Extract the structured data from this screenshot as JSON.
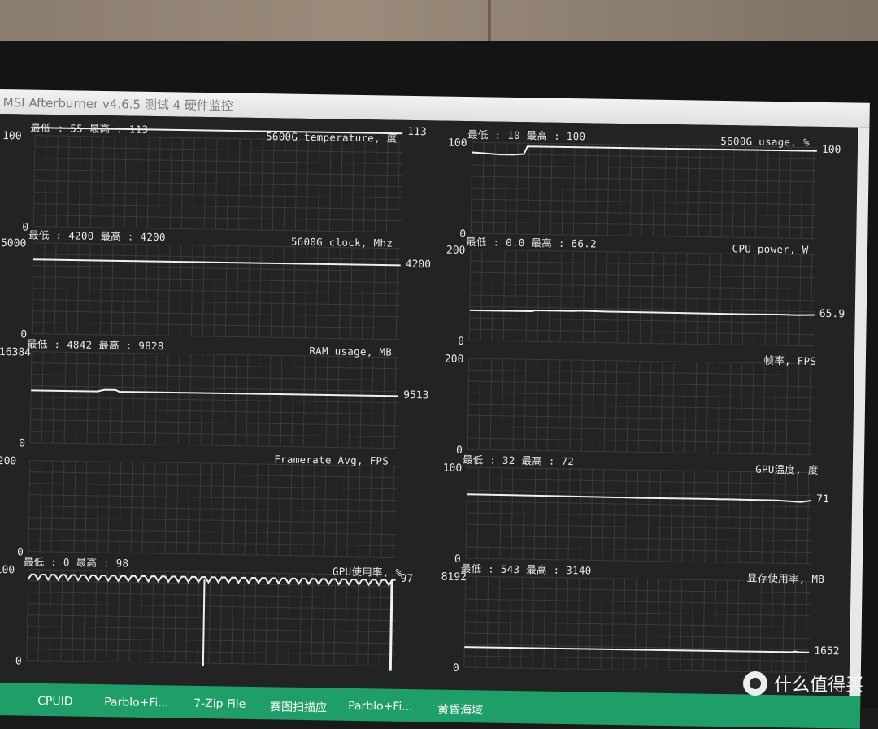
{
  "window": {
    "title": "MSI Afterburner v4.6.5 测试 4 硬件监控"
  },
  "graphs": [
    {
      "id": "cpu-temp",
      "title": "5600G temperature, 度",
      "stats": "最低 : 55  最高 : 113",
      "ymax": "100",
      "ymin": "0",
      "current": "113",
      "y_scale_max": 100,
      "trace": [
        [
          0,
          113
        ],
        [
          1,
          113
        ]
      ]
    },
    {
      "id": "cpu-usage",
      "title": "5600G usage, %",
      "stats": "最低 : 10  最高 : 100",
      "ymax": "100",
      "ymin": "0",
      "current": "100",
      "y_scale_max": 100,
      "trace": [
        [
          0,
          92
        ],
        [
          0.04,
          91
        ],
        [
          0.08,
          90
        ],
        [
          0.12,
          90
        ],
        [
          0.15,
          91
        ],
        [
          0.16,
          100
        ],
        [
          1,
          100
        ]
      ]
    },
    {
      "id": "cpu-clock",
      "title": "5600G clock, Mhz",
      "stats": "最低 : 4200  最高 : 4200",
      "ymax": "5000",
      "ymin": "0",
      "current": "4200",
      "y_scale_max": 5000,
      "trace": [
        [
          0,
          4200
        ],
        [
          1,
          4200
        ]
      ]
    },
    {
      "id": "cpu-power",
      "title": "CPU power, W",
      "stats": "最低 : 0.0  最高 : 66.2",
      "ymax": "200",
      "ymin": "0",
      "current": "65.9",
      "y_scale_max": 200,
      "trace": [
        [
          0,
          64
        ],
        [
          0.18,
          64
        ],
        [
          0.19,
          66
        ],
        [
          0.3,
          66
        ],
        [
          0.32,
          67
        ],
        [
          0.4,
          66
        ],
        [
          0.6,
          65.5
        ],
        [
          0.8,
          65
        ],
        [
          0.9,
          65.5
        ],
        [
          0.95,
          64.8
        ],
        [
          1,
          65.9
        ]
      ]
    },
    {
      "id": "ram-usage",
      "title": "RAM usage, MB",
      "stats": "最低 : 4842  最高 : 9828",
      "ymax": "16384",
      "ymin": "0",
      "current": "9513",
      "y_scale_max": 16384,
      "trace": [
        [
          0,
          9500
        ],
        [
          0.18,
          9500
        ],
        [
          0.2,
          9828
        ],
        [
          0.23,
          9828
        ],
        [
          0.24,
          9513
        ],
        [
          1,
          9513
        ]
      ]
    },
    {
      "id": "fps",
      "title": "帧率, FPS",
      "stats": "",
      "ymax": "200",
      "ymin": "0",
      "current": "",
      "y_scale_max": 200,
      "trace": []
    },
    {
      "id": "fps-avg",
      "title": "Framerate Avg, FPS",
      "stats": "",
      "ymax": "200",
      "ymin": "0",
      "current": "",
      "y_scale_max": 200,
      "trace": []
    },
    {
      "id": "gpu-temp",
      "title": "GPU温度, 度",
      "stats": "最低 : 32  最高 : 72",
      "ymax": "100",
      "ymin": "0",
      "current": "71",
      "y_scale_max": 100,
      "trace": [
        [
          0,
          72
        ],
        [
          0.3,
          71.5
        ],
        [
          0.5,
          71
        ],
        [
          0.7,
          71
        ],
        [
          0.9,
          70.5
        ],
        [
          0.97,
          69
        ],
        [
          1,
          71
        ]
      ]
    },
    {
      "id": "gpu-usage",
      "title": "GPU使用率, %",
      "stats": "最低 : 0  最高 : 98",
      "ymax": "100",
      "ymin": "0",
      "current": "97",
      "y_scale_max": 100,
      "trace": "zigzag"
    },
    {
      "id": "vram-usage",
      "title": "显存使用率, MB",
      "stats": "最低 : 543  最高 : 3140",
      "ymax": "8192",
      "ymin": "0",
      "current": "1652",
      "y_scale_max": 8192,
      "trace": [
        [
          0,
          1652
        ],
        [
          0.95,
          1652
        ],
        [
          0.96,
          1720
        ],
        [
          0.97,
          1652
        ],
        [
          1,
          1652
        ]
      ]
    }
  ],
  "taskbar": {
    "items": [
      "CPUID",
      "Parblo+Fi...",
      "7-Zip File",
      "赛图扫描应",
      "Parblo+Fi...",
      "黄昏海域"
    ]
  },
  "watermark": {
    "text": "什么值得买"
  },
  "colors": {
    "graph_bg": "#232323",
    "grid": "#3a3a3a",
    "trace": "#f0f0f0",
    "taskbar": "#1e9e68"
  }
}
